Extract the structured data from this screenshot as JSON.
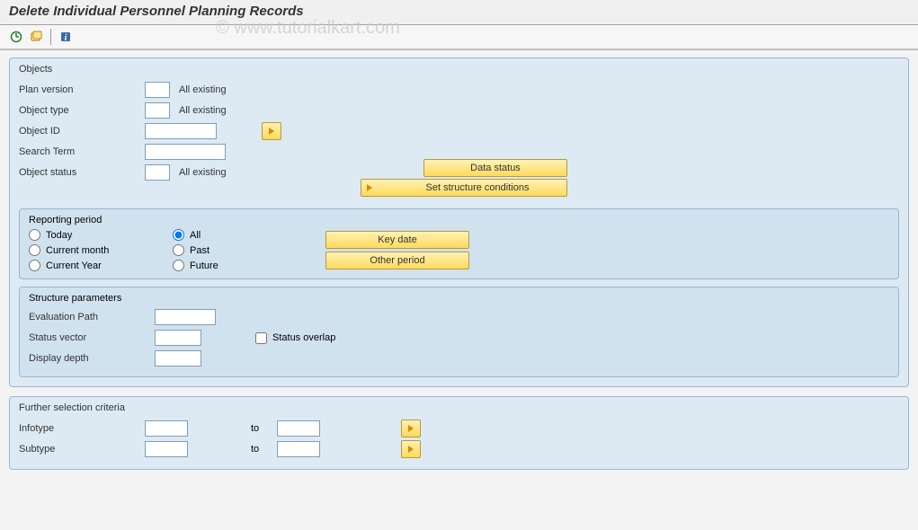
{
  "watermark": "© www.tutorialkart.com",
  "title": "Delete Individual Personnel Planning Records",
  "objects": {
    "title": "Objects",
    "plan_version_label": "Plan version",
    "plan_version_after": "All existing",
    "object_type_label": "Object type",
    "object_type_after": "All existing",
    "object_id_label": "Object ID",
    "search_term_label": "Search Term",
    "object_status_label": "Object status",
    "object_status_after": "All existing",
    "data_status_btn": "Data status",
    "set_structure_btn": "Set structure conditions"
  },
  "reporting": {
    "title": "Reporting period",
    "today": "Today",
    "all": "All",
    "current_month": "Current month",
    "past": "Past",
    "current_year": "Current Year",
    "future": "Future",
    "key_date_btn": "Key date",
    "other_period_btn": "Other period"
  },
  "structure": {
    "title": "Structure parameters",
    "eval_path": "Evaluation Path",
    "status_vector": "Status vector",
    "status_overlap": "Status overlap",
    "display_depth": "Display depth"
  },
  "further": {
    "title": "Further selection criteria",
    "infotype": "Infotype",
    "subtype": "Subtype",
    "to": "to"
  }
}
